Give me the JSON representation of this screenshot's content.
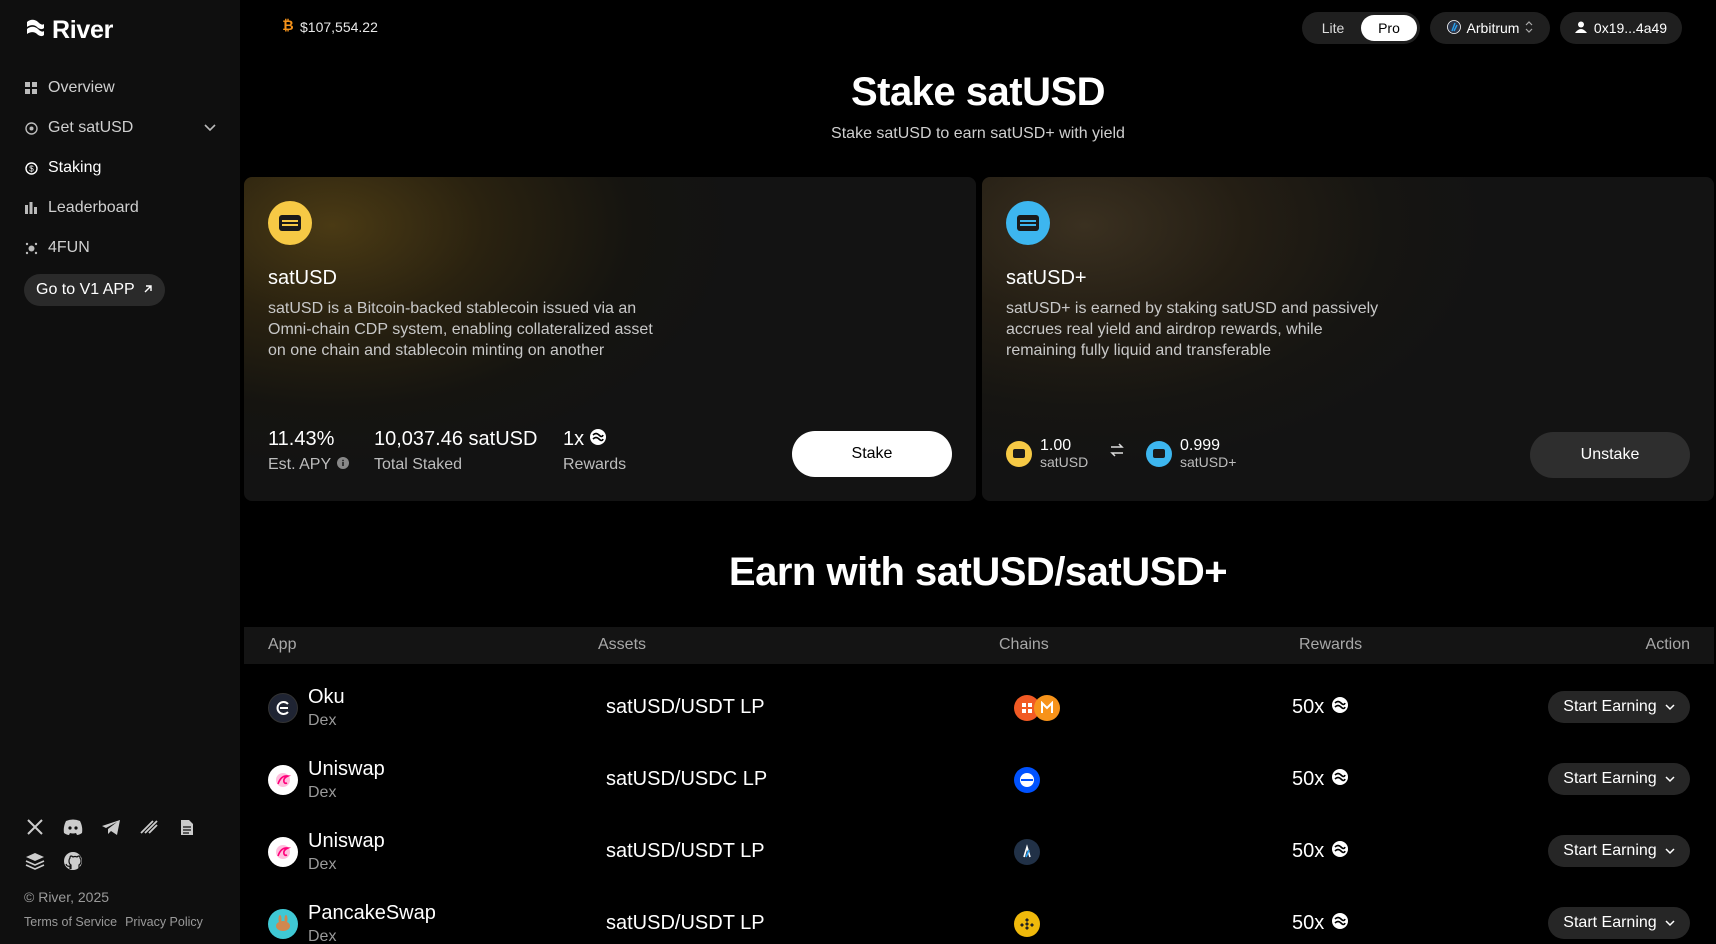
{
  "brand": {
    "name": "River"
  },
  "sidebar": {
    "items": [
      {
        "label": "Overview",
        "icon": "grid-icon"
      },
      {
        "label": "Get satUSD",
        "icon": "circle-icon"
      },
      {
        "label": "Staking",
        "icon": "dollar-icon",
        "active": true
      },
      {
        "label": "Leaderboard",
        "icon": "chart-icon"
      },
      {
        "label": "4FUN",
        "icon": "splash-icon"
      }
    ],
    "v1_button": "Go to V1 APP",
    "copyright": "© River, 2025",
    "terms": "Terms of Service",
    "privacy": "Privacy Policy"
  },
  "header": {
    "btc_price": "$107,554.22",
    "mode_lite": "Lite",
    "mode_pro": "Pro",
    "mode_selected": "Pro",
    "chain": "Arbitrum",
    "wallet": "0x19...4a49"
  },
  "page": {
    "title": "Stake satUSD",
    "subtitle": "Stake satUSD to earn satUSD+ with yield"
  },
  "card_satusd": {
    "name": "satUSD",
    "description": "satUSD is a Bitcoin-backed stablecoin issued via an Omni-chain CDP system, enabling collateralized asset on one chain and stablecoin minting on another",
    "apy_value": "11.43%",
    "apy_label": "Est. APY",
    "staked_value": "10,037.46 satUSD",
    "staked_label": "Total Staked",
    "rewards_value": "1x",
    "rewards_label": "Rewards",
    "button": "Stake"
  },
  "card_satusdplus": {
    "name": "satUSD+",
    "description": "satUSD+ is earned by staking satUSD and passively accrues real yield and airdrop rewards, while remaining fully liquid and transferable",
    "from_value": "1.00",
    "from_label": "satUSD",
    "to_value": "0.999",
    "to_label": "satUSD+",
    "button": "Unstake"
  },
  "earn": {
    "title": "Earn with satUSD/satUSD+",
    "columns": [
      "App",
      "Assets",
      "Chains",
      "Rewards",
      "Action"
    ],
    "rows": [
      {
        "app": "Oku",
        "type": "Dex",
        "asset": "satUSD/USDT LP",
        "reward": "50x",
        "action": "Start Earning"
      },
      {
        "app": "Uniswap",
        "type": "Dex",
        "asset": "satUSD/USDC LP",
        "reward": "50x",
        "action": "Start Earning"
      },
      {
        "app": "Uniswap",
        "type": "Dex",
        "asset": "satUSD/USDT LP",
        "reward": "50x",
        "action": "Start Earning"
      },
      {
        "app": "PancakeSwap",
        "type": "Dex",
        "asset": "satUSD/USDT LP",
        "reward": "50x",
        "action": "Start Earning"
      }
    ]
  },
  "colors": {
    "gold": "#f6c945",
    "blue": "#3db6ef",
    "background": "#000000",
    "sidebar": "#0f0f0f"
  }
}
